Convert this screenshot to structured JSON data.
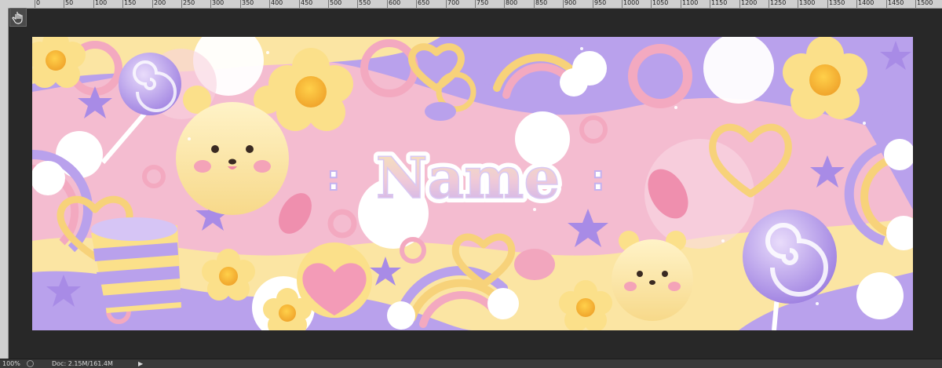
{
  "ruler": {
    "ticks": [
      "0",
      "50",
      "100",
      "150",
      "200",
      "250",
      "300",
      "350",
      "400",
      "450",
      "500",
      "550",
      "600",
      "650",
      "700",
      "750",
      "800",
      "850",
      "900",
      "950",
      "1000",
      "1050",
      "1100",
      "1150",
      "1200",
      "1250",
      "1300",
      "1350",
      "1400",
      "1450",
      "1500"
    ]
  },
  "toolbar": {
    "tool_icon": "hand-pointer-icon"
  },
  "canvas": {
    "title_text": "Name",
    "side_marks": [
      ":",
      ":"
    ],
    "colors": {
      "pink": "#f6bfd2",
      "purple": "#b7a0ec",
      "yellow": "#fbe6a0",
      "white": "#ffffff",
      "title_fill": "#f3dba6",
      "title_outline": "#ffffff"
    }
  },
  "status": {
    "zoom": "100%",
    "doc": "Doc: 2.15M/161.4M",
    "arrow": "▶"
  }
}
